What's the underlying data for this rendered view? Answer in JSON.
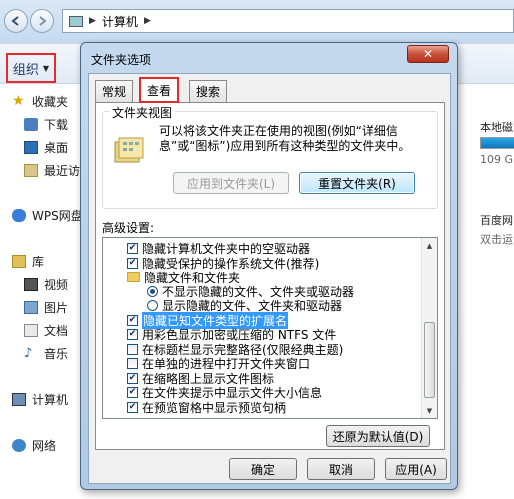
{
  "explorer": {
    "breadcrumb": "计算机",
    "organize_label": "组织",
    "nav": {
      "favorites": "收藏夹",
      "downloads": "下载",
      "desktop": "桌面",
      "recent": "最近访",
      "wps": "WPS网盘",
      "libraries": "库",
      "videos": "视频",
      "pictures": "图片",
      "documents": "文档",
      "music": "音乐",
      "computer": "计算机",
      "network": "网络"
    },
    "right_pane": {
      "disk_label": "本地磁",
      "disk_size": "109 G",
      "baidu_label": "百度网",
      "baidu_sub": "双击运"
    }
  },
  "dialog": {
    "title": "文件夹选项",
    "close_glyph": "✕",
    "tabs": [
      {
        "label": "常规"
      },
      {
        "label": "查看"
      },
      {
        "label": "搜索"
      }
    ],
    "folder_views": {
      "label": "文件夹视图",
      "description": "可以将该文件夹正在使用的视图(例如“详细信息”或“图标”)应用到所有这种类型的文件夹中。",
      "apply_button": "应用到文件夹(L)",
      "reset_button": "重置文件夹(R)"
    },
    "advanced_label": "高级设置:",
    "settings": [
      {
        "text": "隐藏计算机文件夹中的空驱动器",
        "type": "checkbox",
        "checked": true
      },
      {
        "text": "隐藏受保护的操作系统文件(推荐)",
        "type": "checkbox",
        "checked": true
      },
      {
        "text": "隐藏文件和文件夹",
        "type": "folder"
      },
      {
        "text": "不显示隐藏的文件、文件夹或驱动器",
        "type": "radio",
        "checked": true
      },
      {
        "text": "显示隐藏的文件、文件夹和驱动器",
        "type": "radio",
        "checked": false
      },
      {
        "text": "隐藏已知文件类型的扩展名",
        "type": "checkbox",
        "checked": true,
        "selected": true
      },
      {
        "text": "用彩色显示加密或压缩的 NTFS 文件",
        "type": "checkbox",
        "checked": true
      },
      {
        "text": "在标题栏显示完整路径(仅限经典主题)",
        "type": "checkbox",
        "checked": false
      },
      {
        "text": "在单独的进程中打开文件夹窗口",
        "type": "checkbox",
        "checked": false
      },
      {
        "text": "在缩略图上显示文件图标",
        "type": "checkbox",
        "checked": true
      },
      {
        "text": "在文件夹提示中显示文件大小信息",
        "type": "checkbox",
        "checked": true
      },
      {
        "text": "在预览窗格中显示预览句柄",
        "type": "checkbox",
        "checked": true
      }
    ],
    "restore_button": "还原为默认值(D)",
    "ok_button": "确定",
    "cancel_button": "取消",
    "apply_button": "应用(A)",
    "check_glyph": "✔"
  }
}
